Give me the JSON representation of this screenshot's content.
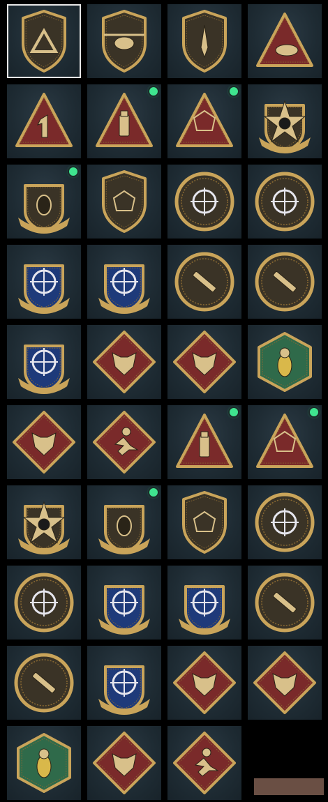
{
  "colors": {
    "tile_bg": "#1e2b33",
    "gold": "#c9a45a",
    "dark_gold": "#8a6a33",
    "red": "#7a2a2a",
    "navy": "#1e3a7a",
    "green": "#2f6a4a",
    "indicator": "#3fe58f",
    "action_bar": "#6a4f44"
  },
  "emblems": [
    {
      "icon": "mountain-peak-shield-icon",
      "selected": true,
      "new": false
    },
    {
      "icon": "helicopter-shield-icon",
      "selected": false,
      "new": false
    },
    {
      "icon": "dagger-shield-icon",
      "selected": false,
      "new": false
    },
    {
      "icon": "bird-triangle-icon",
      "selected": false,
      "new": false
    },
    {
      "icon": "number-one-triangle-icon",
      "selected": false,
      "new": false
    },
    {
      "icon": "usb-triangle-icon",
      "selected": false,
      "new": true
    },
    {
      "icon": "hands-d20-triangle-icon",
      "selected": false,
      "new": true
    },
    {
      "icon": "skull-star-badge-icon",
      "selected": false,
      "new": false
    },
    {
      "icon": "winged-shield-crest-icon",
      "selected": false,
      "new": true
    },
    {
      "icon": "d20-shield-icon",
      "selected": false,
      "new": false
    },
    {
      "icon": "masked-head-crosshair-icon",
      "selected": false,
      "new": false
    },
    {
      "icon": "gasmask-crosshair-icon",
      "selected": false,
      "new": false
    },
    {
      "icon": "rifle-crosshair-ribbon-icon",
      "selected": false,
      "new": false
    },
    {
      "icon": "rifle-crosshair-ribbon-icon",
      "selected": false,
      "new": false
    },
    {
      "icon": "rifle-circle-shield-icon",
      "selected": false,
      "new": false
    },
    {
      "icon": "sniper-circle-shield-icon",
      "selected": false,
      "new": false
    },
    {
      "icon": "rocket-crosshair-crest-icon",
      "selected": false,
      "new": false
    },
    {
      "icon": "wolf-diamond-icon",
      "selected": false,
      "new": false
    },
    {
      "icon": "wolf-diamond-icon",
      "selected": false,
      "new": false
    },
    {
      "icon": "wasp-hexagon-icon",
      "selected": false,
      "new": false
    },
    {
      "icon": "dragon-diamond-icon",
      "selected": false,
      "new": false
    },
    {
      "icon": "running-figure-diamond-icon",
      "selected": false,
      "new": false
    },
    {
      "icon": "usb-triangle-icon",
      "selected": false,
      "new": true
    },
    {
      "icon": "hands-d20-triangle-icon",
      "selected": false,
      "new": true
    },
    {
      "icon": "skull-star-badge-icon",
      "selected": false,
      "new": false
    },
    {
      "icon": "winged-shield-crest-icon",
      "selected": false,
      "new": true
    },
    {
      "icon": "d20-shield-icon",
      "selected": false,
      "new": false
    },
    {
      "icon": "masked-head-crosshair-icon",
      "selected": false,
      "new": false
    },
    {
      "icon": "gasmask-crosshair-icon",
      "selected": false,
      "new": false
    },
    {
      "icon": "rifle-crosshair-ribbon-icon",
      "selected": false,
      "new": false
    },
    {
      "icon": "rifle-crosshair-ribbon-icon",
      "selected": false,
      "new": false
    },
    {
      "icon": "rifle-circle-shield-icon",
      "selected": false,
      "new": false
    },
    {
      "icon": "sniper-circle-shield-icon",
      "selected": false,
      "new": false
    },
    {
      "icon": "rocket-crosshair-crest-icon",
      "selected": false,
      "new": false
    },
    {
      "icon": "wolf-diamond-icon",
      "selected": false,
      "new": false
    },
    {
      "icon": "wolf-diamond-icon",
      "selected": false,
      "new": false
    },
    {
      "icon": "wasp-hexagon-icon",
      "selected": false,
      "new": false
    },
    {
      "icon": "dragon-diamond-icon",
      "selected": false,
      "new": false
    },
    {
      "icon": "running-figure-diamond-icon",
      "selected": false,
      "new": false
    }
  ]
}
